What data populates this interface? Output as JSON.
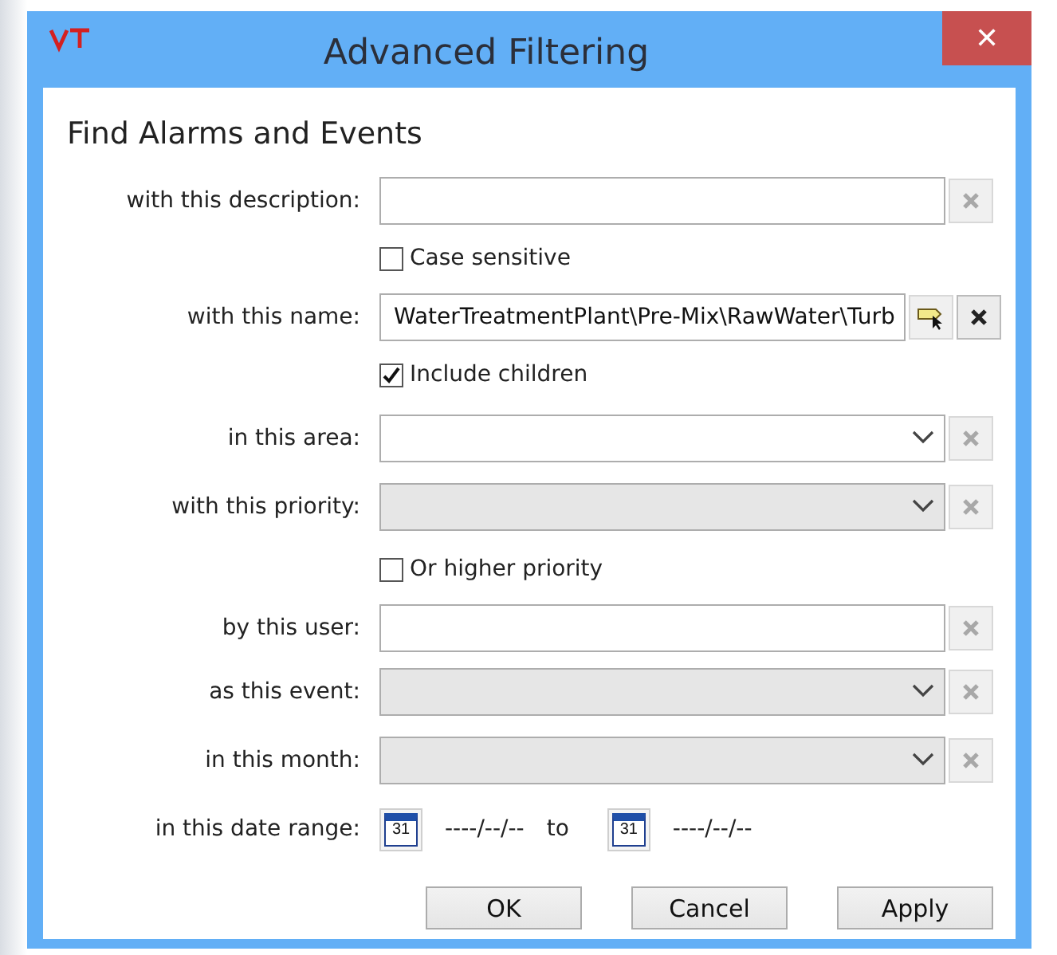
{
  "window": {
    "title": "Advanced Filtering",
    "close": "✕"
  },
  "heading": "Find Alarms and Events",
  "rows": [
    {
      "kind": "text",
      "label": "with this description:",
      "value": "",
      "clear_enabled": false
    },
    {
      "kind": "check",
      "label": "Case sensitive",
      "checked": false
    },
    {
      "kind": "text",
      "label": "with this name:",
      "value": "WaterTreatmentPlant\\Pre-Mix\\RawWater\\Turb",
      "browse": true,
      "clear_enabled": true
    },
    {
      "kind": "check",
      "label": "Include children",
      "checked": true
    },
    {
      "kind": "combo",
      "label": "in this area:",
      "disabled": false,
      "clear_enabled": false
    },
    {
      "kind": "combo",
      "label": "with this priority:",
      "disabled": true,
      "clear_enabled": false
    },
    {
      "kind": "check",
      "label": "Or higher priority",
      "checked": false
    },
    {
      "kind": "text",
      "label": "by this user:",
      "value": "",
      "clear_enabled": false
    },
    {
      "kind": "combo",
      "label": "as this event:",
      "disabled": true,
      "clear_enabled": false
    },
    {
      "kind": "combo",
      "label": "in this month:",
      "disabled": true,
      "clear_enabled": false
    },
    {
      "kind": "daterange",
      "label": "in this date range:",
      "from_day": "31",
      "from": "----/--/--",
      "separator": "to",
      "to_day": "31",
      "to": "----/--/--"
    }
  ],
  "buttons": [
    "OK",
    "Cancel",
    "Apply"
  ]
}
